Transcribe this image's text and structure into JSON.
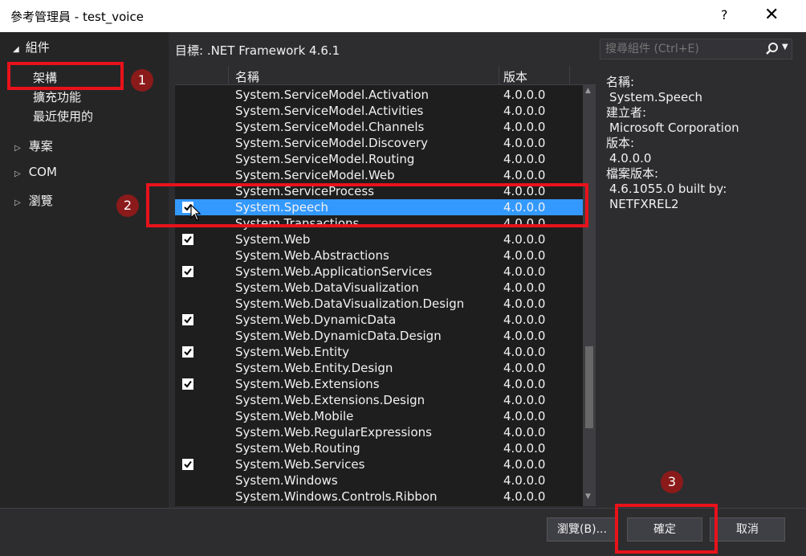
{
  "window": {
    "title": "參考管理員 - test_voice",
    "help_label": "?",
    "close_label": "✕"
  },
  "nav": {
    "header": "組件",
    "items": [
      {
        "label": "架構"
      },
      {
        "label": "擴充功能"
      },
      {
        "label": "最近使用的"
      }
    ],
    "groups": [
      {
        "label": "專案"
      },
      {
        "label": "COM"
      },
      {
        "label": "瀏覽"
      }
    ]
  },
  "target": "目標: .NET Framework 4.6.1",
  "search": {
    "placeholder": "搜尋組件 (Ctrl+E)"
  },
  "table": {
    "col_name": "名稱",
    "col_version": "版本",
    "rows": [
      {
        "name": "System.ServiceModel.Activation",
        "version": "4.0.0.0",
        "checked": false,
        "selected": false
      },
      {
        "name": "System.ServiceModel.Activities",
        "version": "4.0.0.0",
        "checked": false,
        "selected": false
      },
      {
        "name": "System.ServiceModel.Channels",
        "version": "4.0.0.0",
        "checked": false,
        "selected": false
      },
      {
        "name": "System.ServiceModel.Discovery",
        "version": "4.0.0.0",
        "checked": false,
        "selected": false
      },
      {
        "name": "System.ServiceModel.Routing",
        "version": "4.0.0.0",
        "checked": false,
        "selected": false
      },
      {
        "name": "System.ServiceModel.Web",
        "version": "4.0.0.0",
        "checked": false,
        "selected": false
      },
      {
        "name": "System.ServiceProcess",
        "version": "4.0.0.0",
        "checked": false,
        "selected": false
      },
      {
        "name": "System.Speech",
        "version": "4.0.0.0",
        "checked": true,
        "selected": true
      },
      {
        "name": "System.Transactions",
        "version": "4.0.0.0",
        "checked": false,
        "selected": false
      },
      {
        "name": "System.Web",
        "version": "4.0.0.0",
        "checked": true,
        "selected": false
      },
      {
        "name": "System.Web.Abstractions",
        "version": "4.0.0.0",
        "checked": false,
        "selected": false
      },
      {
        "name": "System.Web.ApplicationServices",
        "version": "4.0.0.0",
        "checked": true,
        "selected": false
      },
      {
        "name": "System.Web.DataVisualization",
        "version": "4.0.0.0",
        "checked": false,
        "selected": false
      },
      {
        "name": "System.Web.DataVisualization.Design",
        "version": "4.0.0.0",
        "checked": false,
        "selected": false
      },
      {
        "name": "System.Web.DynamicData",
        "version": "4.0.0.0",
        "checked": true,
        "selected": false
      },
      {
        "name": "System.Web.DynamicData.Design",
        "version": "4.0.0.0",
        "checked": false,
        "selected": false
      },
      {
        "name": "System.Web.Entity",
        "version": "4.0.0.0",
        "checked": true,
        "selected": false
      },
      {
        "name": "System.Web.Entity.Design",
        "version": "4.0.0.0",
        "checked": false,
        "selected": false
      },
      {
        "name": "System.Web.Extensions",
        "version": "4.0.0.0",
        "checked": true,
        "selected": false
      },
      {
        "name": "System.Web.Extensions.Design",
        "version": "4.0.0.0",
        "checked": false,
        "selected": false
      },
      {
        "name": "System.Web.Mobile",
        "version": "4.0.0.0",
        "checked": false,
        "selected": false
      },
      {
        "name": "System.Web.RegularExpressions",
        "version": "4.0.0.0",
        "checked": false,
        "selected": false
      },
      {
        "name": "System.Web.Routing",
        "version": "4.0.0.0",
        "checked": false,
        "selected": false
      },
      {
        "name": "System.Web.Services",
        "version": "4.0.0.0",
        "checked": true,
        "selected": false
      },
      {
        "name": "System.Windows",
        "version": "4.0.0.0",
        "checked": false,
        "selected": false
      },
      {
        "name": "System.Windows.Controls.Ribbon",
        "version": "4.0.0.0",
        "checked": false,
        "selected": false
      }
    ]
  },
  "details": {
    "name_label": "名稱:",
    "name_value": "System.Speech",
    "author_label": "建立者:",
    "author_value": "Microsoft Corporation",
    "version_label": "版本:",
    "version_value": "4.0.0.0",
    "file_version_label": "檔案版本:",
    "file_version_value": "4.6.1055.0 built by: NETFXREL2"
  },
  "buttons": {
    "browse": "瀏覽(B)...",
    "ok": "確定",
    "cancel": "取消"
  },
  "annotations": {
    "badge1": "1",
    "badge2": "2",
    "badge3": "3"
  },
  "colors": {
    "selection": "#3399ff",
    "annotation_red": "#e8121b",
    "badge_bg": "#8b1a1a"
  }
}
